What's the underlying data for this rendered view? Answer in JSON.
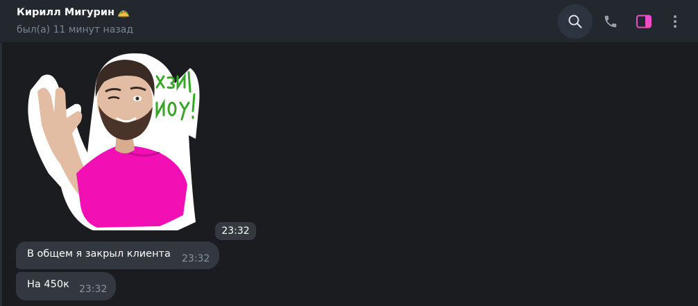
{
  "header": {
    "title": "Кирилл Мигурин",
    "status": "был(а) 11 минут назад"
  },
  "messages": [
    {
      "type": "sticker",
      "sticker_text": "ХЭЙ, ЙОУ!",
      "time": "23:32"
    },
    {
      "type": "text",
      "text": "В общем я закрыл клиента",
      "time": "23:32"
    },
    {
      "type": "text",
      "text": "На 450к",
      "time": "23:32"
    }
  ],
  "icons": {
    "search": "search-icon",
    "call": "phone-icon",
    "panel": "sidebar-toggle-icon",
    "more": "more-vertical-icon",
    "title_emoji": "taco-emoji-icon"
  },
  "colors": {
    "header_bg": "#23272e",
    "chat_bg": "#1b1c20",
    "bubble_bg": "#323740",
    "accent_pink": "#ea4fc3",
    "sticker_shirt": "#f20fb4",
    "sticker_text": "#3aa32b"
  }
}
